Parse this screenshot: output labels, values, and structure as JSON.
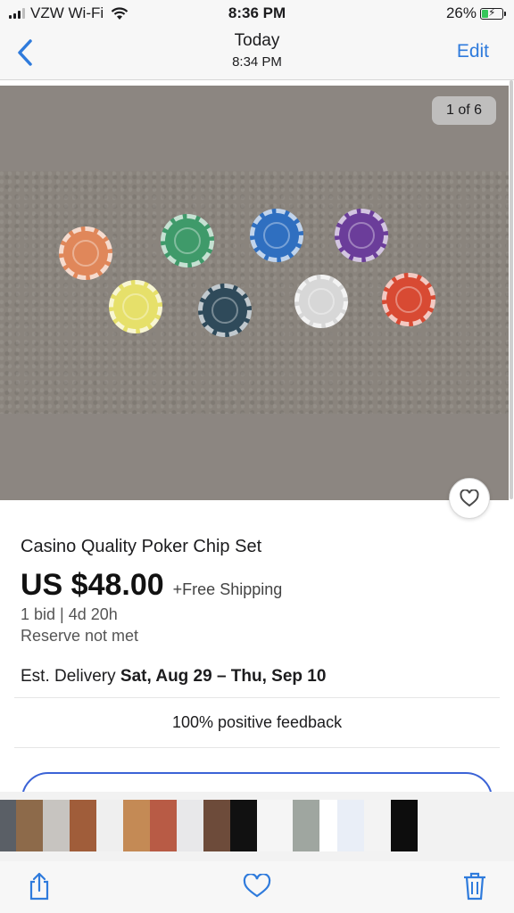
{
  "status_bar": {
    "carrier": "VZW Wi-Fi",
    "time": "8:36 PM",
    "battery_percent": "26%"
  },
  "nav": {
    "title": "Today",
    "subtitle": "8:34 PM",
    "edit_label": "Edit"
  },
  "photo": {
    "counter": "1 of 6"
  },
  "listing": {
    "title": "Casino Quality Poker Chip Set",
    "price": "US $48.00",
    "shipping": "+Free Shipping",
    "bids": "1 bid  |  4d 20h",
    "reserve": "Reserve not met",
    "delivery_label": "Est. Delivery",
    "delivery_dates": "Sat, Aug 29 – Thu, Sep 10",
    "feedback": "100% positive feedback"
  },
  "colors": {
    "accent": "#2f7bdc",
    "outline_button": "#3b63d6",
    "chips": [
      "#e0875a",
      "#3f9a6a",
      "#2f6fc0",
      "#6b3d9a",
      "#e6e06a",
      "#2f4a5a",
      "#d7d7d7",
      "#d84a33"
    ]
  },
  "icons": {
    "back": "chevron-left-icon",
    "favorite": "heart-icon",
    "share": "share-icon",
    "like": "heart-icon",
    "delete": "trash-icon"
  }
}
